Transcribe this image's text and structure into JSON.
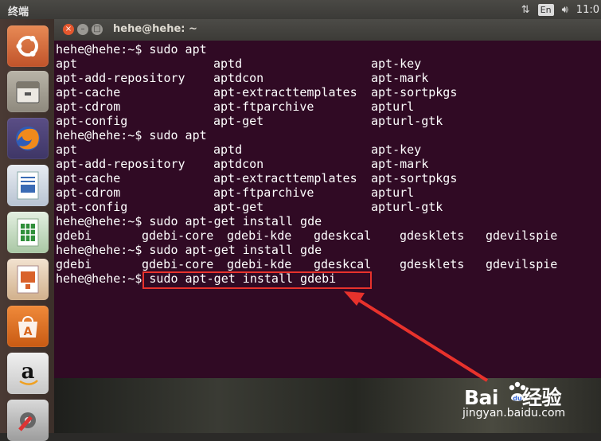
{
  "top_panel": {
    "title": "终端",
    "keyboard": "En",
    "clock": "11:0"
  },
  "launcher": {
    "items": [
      {
        "name": "ubuntu-dash"
      },
      {
        "name": "files"
      },
      {
        "name": "firefox"
      },
      {
        "name": "libreoffice-writer"
      },
      {
        "name": "libreoffice-calc"
      },
      {
        "name": "libreoffice-impress"
      },
      {
        "name": "ubuntu-software-center"
      },
      {
        "name": "amazon"
      },
      {
        "name": "system-settings"
      }
    ]
  },
  "window": {
    "title": "hehe@hehe: ~",
    "close_glyph": "×",
    "min_glyph": "–",
    "max_glyph": "□"
  },
  "terminal": {
    "lines": [
      {
        "cols": [
          "hehe@hehe:~$ sudo apt"
        ]
      },
      {
        "cols": [
          "apt",
          "aptd",
          "apt-key"
        ]
      },
      {
        "cols": [
          "apt-add-repository",
          "aptdcon",
          "apt-mark"
        ]
      },
      {
        "cols": [
          "apt-cache",
          "apt-extracttemplates",
          "apt-sortpkgs"
        ]
      },
      {
        "cols": [
          "apt-cdrom",
          "apt-ftparchive",
          "apturl"
        ]
      },
      {
        "cols": [
          "apt-config",
          "apt-get",
          "apturl-gtk"
        ]
      },
      {
        "cols": [
          "hehe@hehe:~$ sudo apt"
        ]
      },
      {
        "cols": [
          "apt",
          "aptd",
          "apt-key"
        ]
      },
      {
        "cols": [
          "apt-add-repository",
          "aptdcon",
          "apt-mark"
        ]
      },
      {
        "cols": [
          "apt-cache",
          "apt-extracttemplates",
          "apt-sortpkgs"
        ]
      },
      {
        "cols": [
          "apt-cdrom",
          "apt-ftparchive",
          "apturl"
        ]
      },
      {
        "cols": [
          "apt-config",
          "apt-get",
          "apturl-gtk"
        ]
      },
      {
        "cols": [
          "hehe@hehe:~$ sudo apt-get install gde"
        ]
      },
      {
        "cols": [
          "gdebi",
          "gdebi-core",
          "gdebi-kde",
          "gdeskcal",
          "gdesklets",
          "gdevilspie"
        ]
      },
      {
        "cols": [
          "hehe@hehe:~$ sudo apt-get install gde"
        ]
      },
      {
        "cols": [
          "gdebi",
          "gdebi-core",
          "gdebi-kde",
          "gdeskcal",
          "gdesklets",
          "gdevilspie"
        ]
      },
      {
        "cols": [
          "hehe@hehe:~$ sudo apt-get install gdebi"
        ]
      }
    ]
  },
  "watermark": {
    "brand": "Bai",
    "brand_suffix": "经验",
    "url": "jingyan.baidu.com"
  },
  "colors": {
    "terminal_bg": "#300a24",
    "highlight": "#e8322c"
  }
}
